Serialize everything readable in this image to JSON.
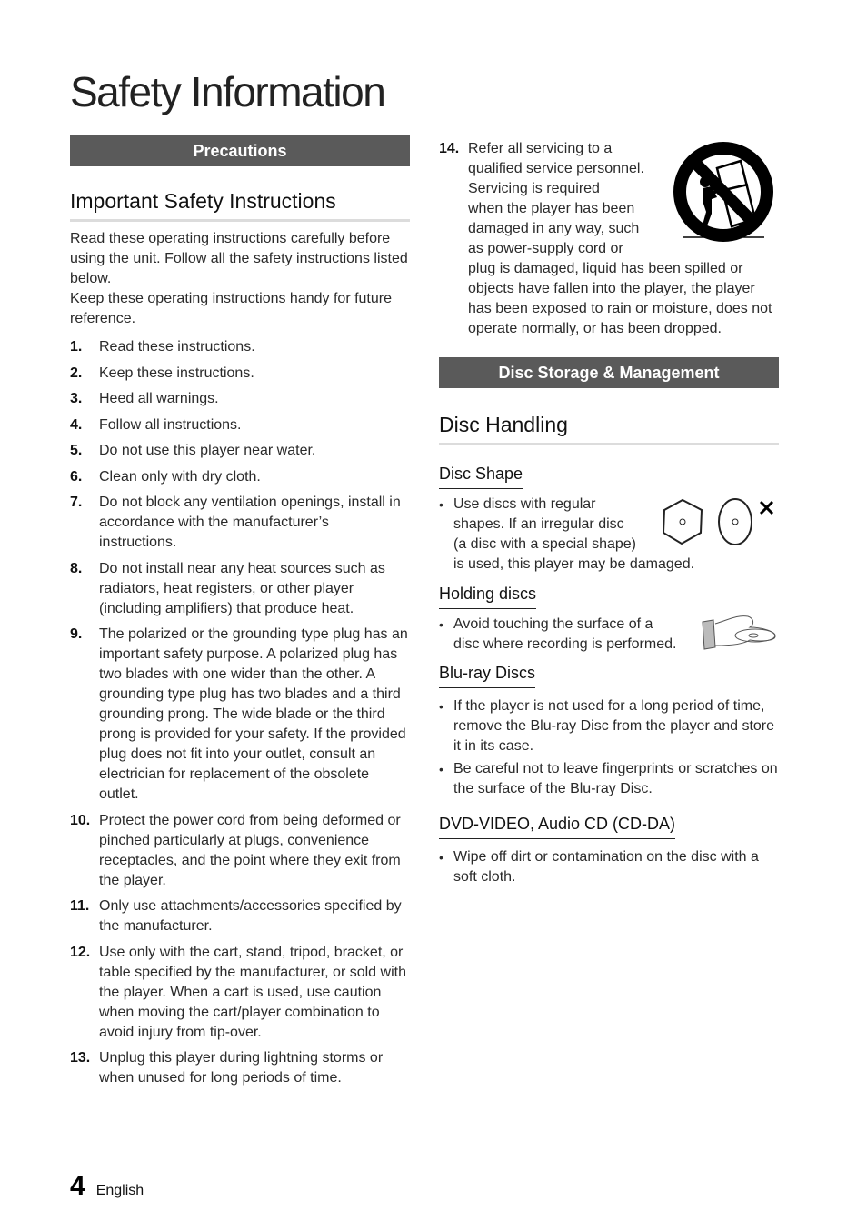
{
  "page": {
    "title": "Safety Information",
    "page_number": "4",
    "language": "English"
  },
  "left": {
    "section_bar": "Precautions",
    "heading": "Important Safety Instructions",
    "intro_1": "Read these operating instructions carefully before using the unit. Follow all the safety instructions listed below.",
    "intro_2": "Keep these operating instructions handy for future reference.",
    "items": [
      {
        "num": "1.",
        "text": "Read these instructions."
      },
      {
        "num": "2.",
        "text": "Keep these instructions."
      },
      {
        "num": "3.",
        "text": "Heed all warnings."
      },
      {
        "num": "4.",
        "text": "Follow all instructions."
      },
      {
        "num": "5.",
        "text": "Do not use this player near water."
      },
      {
        "num": "6.",
        "text": "Clean only with dry cloth."
      },
      {
        "num": "7.",
        "text": "Do not block any ventilation openings, install in accordance with the manufacturer’s instructions."
      },
      {
        "num": "8.",
        "text": "Do not install near any heat sources such as radiators, heat registers, or other player (including amplifiers) that produce heat."
      },
      {
        "num": "9.",
        "text": "The polarized or the grounding type plug has an important safety purpose. A polarized plug has two blades with one wider than the other. A grounding type plug has two blades and a third grounding prong. The wide blade or the third prong is provided for your safety. If the provided plug does not fit into your outlet, consult an electrician for replacement of the obsolete outlet."
      },
      {
        "num": "10.",
        "text": "Protect the power cord from being deformed or pinched particularly at plugs, convenience receptacles, and the point where they exit from the player."
      },
      {
        "num": "11.",
        "text": "Only use attachments/accessories specified by the manufacturer."
      },
      {
        "num": "12.",
        "text": "Use only with the cart, stand, tripod, bracket, or table specified by the manufacturer, or sold with the player. When a cart is used, use caution when moving the cart/player combination to avoid injury from tip-over."
      },
      {
        "num": "13.",
        "text": "Unplug this player during lightning storms or when unused for long periods of time."
      }
    ]
  },
  "right": {
    "item14": {
      "num": "14.",
      "text_wrapped": [
        "Refer all servicing to a",
        "qualified service personnel.",
        "Servicing is required",
        "when the player has been",
        "damaged in any way, such",
        "as power-supply cord or"
      ],
      "text_rest": "plug is damaged, liquid has been spilled or objects have fallen into the player, the player has been exposed to rain or moisture, does not operate normally, or has been dropped.",
      "icon": "cart-tip-over-warning-icon"
    },
    "section_bar": "Disc Storage & Management",
    "heading": "Disc Handling",
    "disc_shape": {
      "title": "Disc Shape",
      "lines": [
        "Use discs with regular",
        "shapes. If an irregular disc",
        "(a disc with a special shape)",
        "is used, this player may be damaged."
      ],
      "icons": [
        "hexagon-disc-icon",
        "oval-disc-icon",
        "cross-mark-icon"
      ]
    },
    "holding": {
      "title": "Holding discs",
      "lines": [
        "Avoid touching the surface of a",
        "disc where recording is performed."
      ],
      "icon": "hand-holding-disc-icon"
    },
    "bluray": {
      "title": "Blu-ray Discs",
      "bullets": [
        "If the player is not used for a long period of time, remove the Blu-ray Disc from the player and store it in its case.",
        "Be careful not to leave fingerprints or scratches on the surface of the Blu-ray Disc."
      ]
    },
    "dvd": {
      "title": "DVD-VIDEO, Audio CD (CD-DA)",
      "bullets": [
        "Wipe off dirt or contamination on the disc with a soft cloth."
      ]
    }
  }
}
